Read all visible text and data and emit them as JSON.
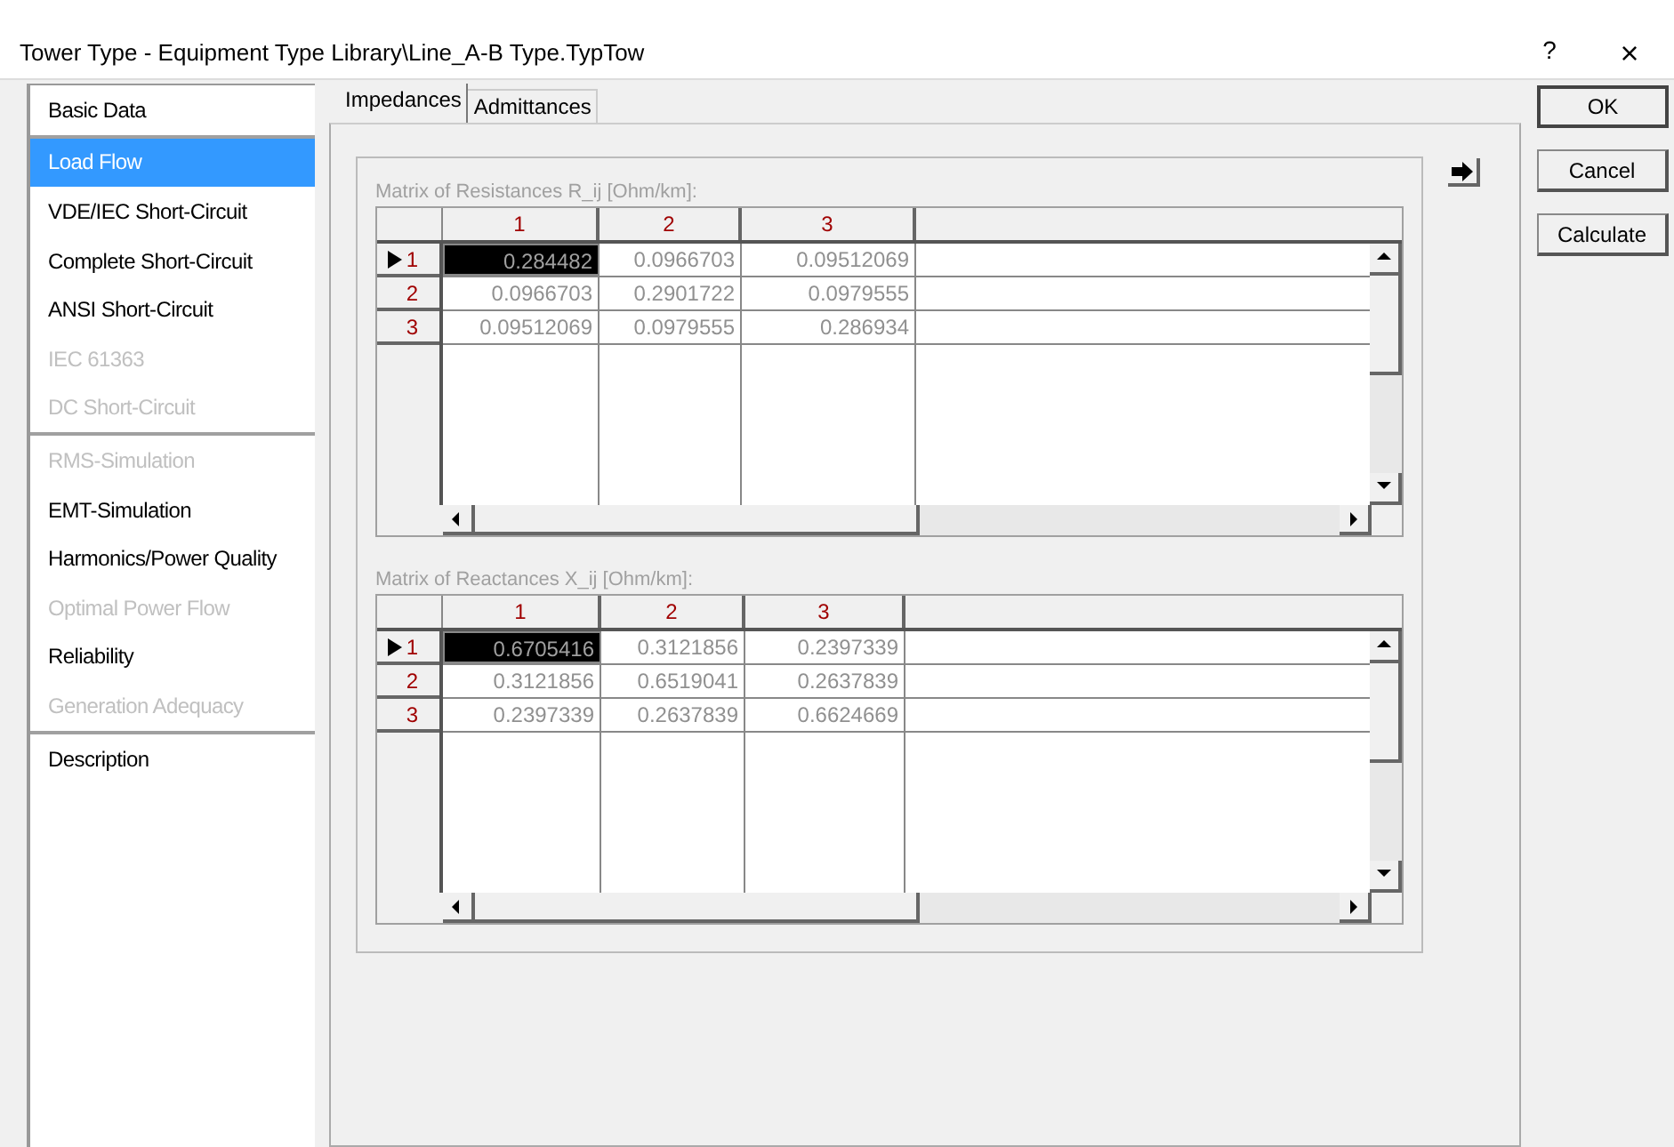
{
  "window": {
    "title": "Tower Type - Equipment Type Library\\Line_A-B Type.TypTow",
    "help": "?",
    "close": "×"
  },
  "sidebar": {
    "groups": [
      {
        "items": [
          {
            "label": "Basic Data",
            "selected": false,
            "disabled": false
          }
        ]
      },
      {
        "items": [
          {
            "label": "Load Flow",
            "selected": true,
            "disabled": false
          },
          {
            "label": "VDE/IEC Short-Circuit",
            "selected": false,
            "disabled": false
          },
          {
            "label": "Complete Short-Circuit",
            "selected": false,
            "disabled": false
          },
          {
            "label": "ANSI Short-Circuit",
            "selected": false,
            "disabled": false
          },
          {
            "label": "IEC 61363",
            "selected": false,
            "disabled": true
          },
          {
            "label": "DC Short-Circuit",
            "selected": false,
            "disabled": true
          }
        ]
      },
      {
        "items": [
          {
            "label": "RMS-Simulation",
            "selected": false,
            "disabled": true
          },
          {
            "label": "EMT-Simulation",
            "selected": false,
            "disabled": false
          },
          {
            "label": "Harmonics/Power Quality",
            "selected": false,
            "disabled": false
          },
          {
            "label": "Optimal Power Flow",
            "selected": false,
            "disabled": true
          },
          {
            "label": "Reliability",
            "selected": false,
            "disabled": false
          },
          {
            "label": "Generation Adequacy",
            "selected": false,
            "disabled": true
          }
        ]
      },
      {
        "items": [
          {
            "label": "Description",
            "selected": false,
            "disabled": false
          }
        ]
      }
    ]
  },
  "tabs": [
    {
      "label": "Impedances",
      "selected": true
    },
    {
      "label": "Admittances",
      "selected": false
    }
  ],
  "matrices": [
    {
      "label": "Matrix of Resistances R_ij [Ohm/km]:",
      "columns": [
        "1",
        "2",
        "3"
      ],
      "rows": [
        {
          "header": "1",
          "selected": true,
          "cells": [
            {
              "value": "0.284482",
              "selected": true
            },
            {
              "value": "0.0966703",
              "selected": false
            },
            {
              "value": "0.09512069",
              "selected": false
            }
          ]
        },
        {
          "header": "2",
          "selected": false,
          "cells": [
            {
              "value": "0.0966703",
              "selected": false
            },
            {
              "value": "0.2901722",
              "selected": false
            },
            {
              "value": "0.0979555",
              "selected": false
            }
          ]
        },
        {
          "header": "3",
          "selected": false,
          "cells": [
            {
              "value": "0.09512069",
              "selected": false
            },
            {
              "value": "0.0979555",
              "selected": false
            },
            {
              "value": "0.286934",
              "selected": false
            }
          ]
        }
      ]
    },
    {
      "label": "Matrix of Reactances X_ij [Ohm/km]:",
      "columns": [
        "1",
        "2",
        "3"
      ],
      "rows": [
        {
          "header": "1",
          "selected": true,
          "cells": [
            {
              "value": "0.6705416",
              "selected": true
            },
            {
              "value": "0.3121856",
              "selected": false
            },
            {
              "value": "0.2397339",
              "selected": false
            }
          ]
        },
        {
          "header": "2",
          "selected": false,
          "cells": [
            {
              "value": "0.3121856",
              "selected": false
            },
            {
              "value": "0.6519041",
              "selected": false
            },
            {
              "value": "0.2637839",
              "selected": false
            }
          ]
        },
        {
          "header": "3",
          "selected": false,
          "cells": [
            {
              "value": "0.2397339",
              "selected": false
            },
            {
              "value": "0.2637839",
              "selected": false
            },
            {
              "value": "0.6624669",
              "selected": false
            }
          ]
        }
      ]
    }
  ],
  "buttons": [
    {
      "label": "OK",
      "default": true
    },
    {
      "label": "Cancel",
      "default": false
    },
    {
      "label": "Calculate",
      "default": false
    }
  ]
}
